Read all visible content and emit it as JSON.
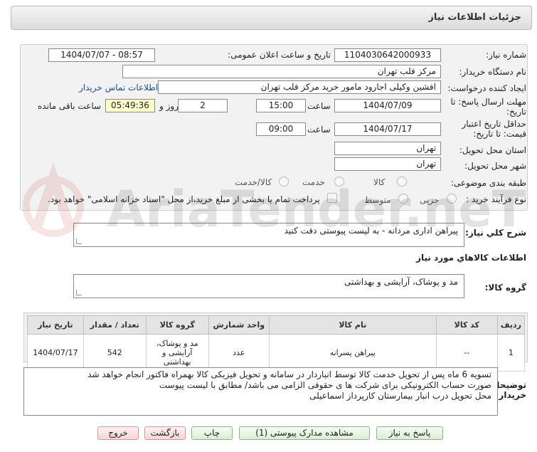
{
  "header": {
    "title": "جزئیات اطلاعات نیاز"
  },
  "form": {
    "need_number_label": "شماره نیاز:",
    "need_number": "1104030642000933",
    "announce_label": "تاریخ و ساعت اعلان عمومی:",
    "announce_value": "1404/07/07 - 08:57",
    "buyer_org_label": "نام دستگاه خریدار:",
    "buyer_org": "مرکز قلب تهران",
    "creator_label": "ایجاد کننده درخواست:",
    "creator": "افشین وکیلی اجارود مامور خرید مرکز قلب تهران",
    "contact_link": "اطلاعات تماس خریدار",
    "deadline_label_1": "مهلت ارسال پاسخ: تا",
    "deadline_label_2": "تاریخ:",
    "deadline_date": "1404/07/09",
    "time_label": "ساعت",
    "deadline_time": "15:00",
    "days": "2",
    "days_label": "روز و",
    "remaining_time": "05:49:36",
    "remaining_label": "ساعت باقی مانده",
    "validity_label_1": "حداقل تاریخ اعتبار",
    "validity_label_2": "قیمت: تا تاریخ:",
    "validity_date": "1404/07/17",
    "validity_time_label": "ساعت",
    "validity_time": "09:00",
    "province_label": "استان محل تحویل:",
    "province": "تهران",
    "city_label": "شهر محل تحویل:",
    "city": "تهران",
    "category_label": "طبقه بندی موضوعی:",
    "category_options": [
      "کالا",
      "خدمت",
      "کالا/خدمت"
    ],
    "process_label": "نوع فرآیند خرید :",
    "process_options": [
      "جزیی",
      "متوسط"
    ],
    "payment_note": "پرداخت تمام یا بخشی از مبلغ خرید،از محل \"اسناد خزانه اسلامی\" خواهد بود."
  },
  "summary": {
    "label": "شرح كلي نياز:",
    "text": "پیراهن اداری مردانه - به لیست پیوستی دقت کنید"
  },
  "goods_section": {
    "title": "اطلاعات كالاهاي مورد نياز",
    "group_label": "گروه كالا:",
    "group_value": "مد و پوشاک، آرایشی و بهداشتی"
  },
  "table": {
    "headers": [
      "ردیف",
      "کد کالا",
      "نام کالا",
      "واحد شمارش",
      "گروه کالا",
      "تعداد / مقدار",
      "تاریخ نیاز"
    ],
    "rows": [
      [
        "1",
        "--",
        "پیراهن پسرانه",
        "عدد",
        "مد و پوشاک، آرایشی و بهداشتی",
        "542",
        "1404/07/17"
      ]
    ]
  },
  "notes": {
    "label_1": "توضیحات",
    "label_2": "خریدار:",
    "lines": [
      "تسویه 6 ماه پس از تحویل خدمت کالا توسط انباردار در سامانه و تحویل فیزیکی کالا بهمراه فاکتور انجام خواهد شد",
      "صورت حساب الکترونیکی برای شرکت ها ی حقوقی الزامی می باشد/ مطابق با لیست پیوست",
      "محل تحویل درب انبار بیمارستان کارپرداز اسماعیلی"
    ]
  },
  "buttons": {
    "reply": "پاسخ به نیاز",
    "attachments": "مشاهده مدارک پیوستی (1)",
    "print": "چاپ",
    "back": "بازگشت",
    "exit": "خروج"
  },
  "watermark": "AriaTender.neT",
  "colors": {
    "accent_link": "#1a4fa0",
    "panel_bg": "#f2f2f2",
    "remaining_bg": "#ffffcc"
  }
}
